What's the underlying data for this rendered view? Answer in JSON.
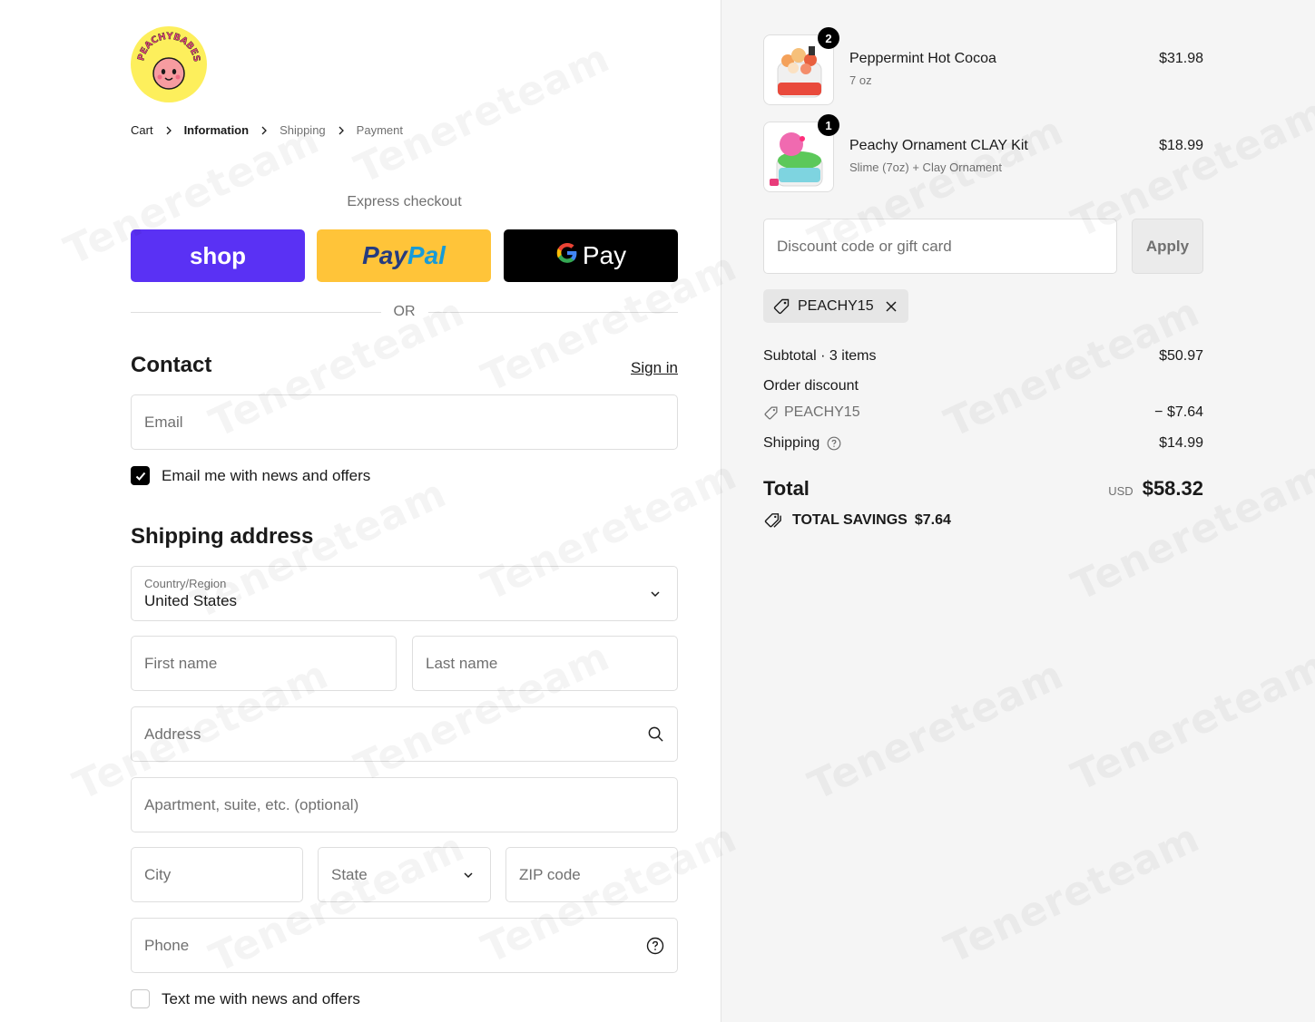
{
  "brand": {
    "logo_text": "PEACHYBABES"
  },
  "breadcrumb": {
    "cart": "Cart",
    "information": "Information",
    "shipping": "Shipping",
    "payment": "Payment"
  },
  "express": {
    "label": "Express checkout",
    "shop": "shop",
    "paypal_1": "Pay",
    "paypal_2": "Pal",
    "gpay_g": "G",
    "gpay": "Pay",
    "or": "OR"
  },
  "contact": {
    "title": "Contact",
    "sign_in": "Sign in",
    "email_placeholder": "Email",
    "newsletter_label": "Email me with news and offers",
    "newsletter_checked": true
  },
  "shipping": {
    "title": "Shipping address",
    "country_label": "Country/Region",
    "country_value": "United States",
    "first_name": "First name",
    "last_name": "Last name",
    "address": "Address",
    "apartment": "Apartment, suite, etc. (optional)",
    "city": "City",
    "state": "State",
    "zip": "ZIP code",
    "phone": "Phone",
    "sms_label": "Text me with news and offers",
    "sms_checked": false
  },
  "summary": {
    "items": [
      {
        "qty": "2",
        "name": "Peppermint Hot Cocoa",
        "variant": "7 oz",
        "price": "$31.98"
      },
      {
        "qty": "1",
        "name": "Peachy Ornament CLAY Kit",
        "variant": "Slime (7oz) + Clay Ornament",
        "price": "$18.99"
      }
    ],
    "discount_placeholder": "Discount code or gift card",
    "apply": "Apply",
    "applied_code": "PEACHY15",
    "subtotal_label": "Subtotal · 3 items",
    "subtotal": "$50.97",
    "order_discount_label": "Order discount",
    "discount_code": "PEACHY15",
    "discount_amount": "− $7.64",
    "shipping_label": "Shipping",
    "shipping": "$14.99",
    "total_label": "Total",
    "currency": "USD",
    "total": "$58.32",
    "savings_label": "TOTAL SAVINGS",
    "savings": "$7.64"
  },
  "watermark": "Tenereteam",
  "colors": {
    "shop": "#5a31f4",
    "paypal": "#ffc439",
    "gpay": "#000000",
    "panel": "#f5f5f5"
  }
}
